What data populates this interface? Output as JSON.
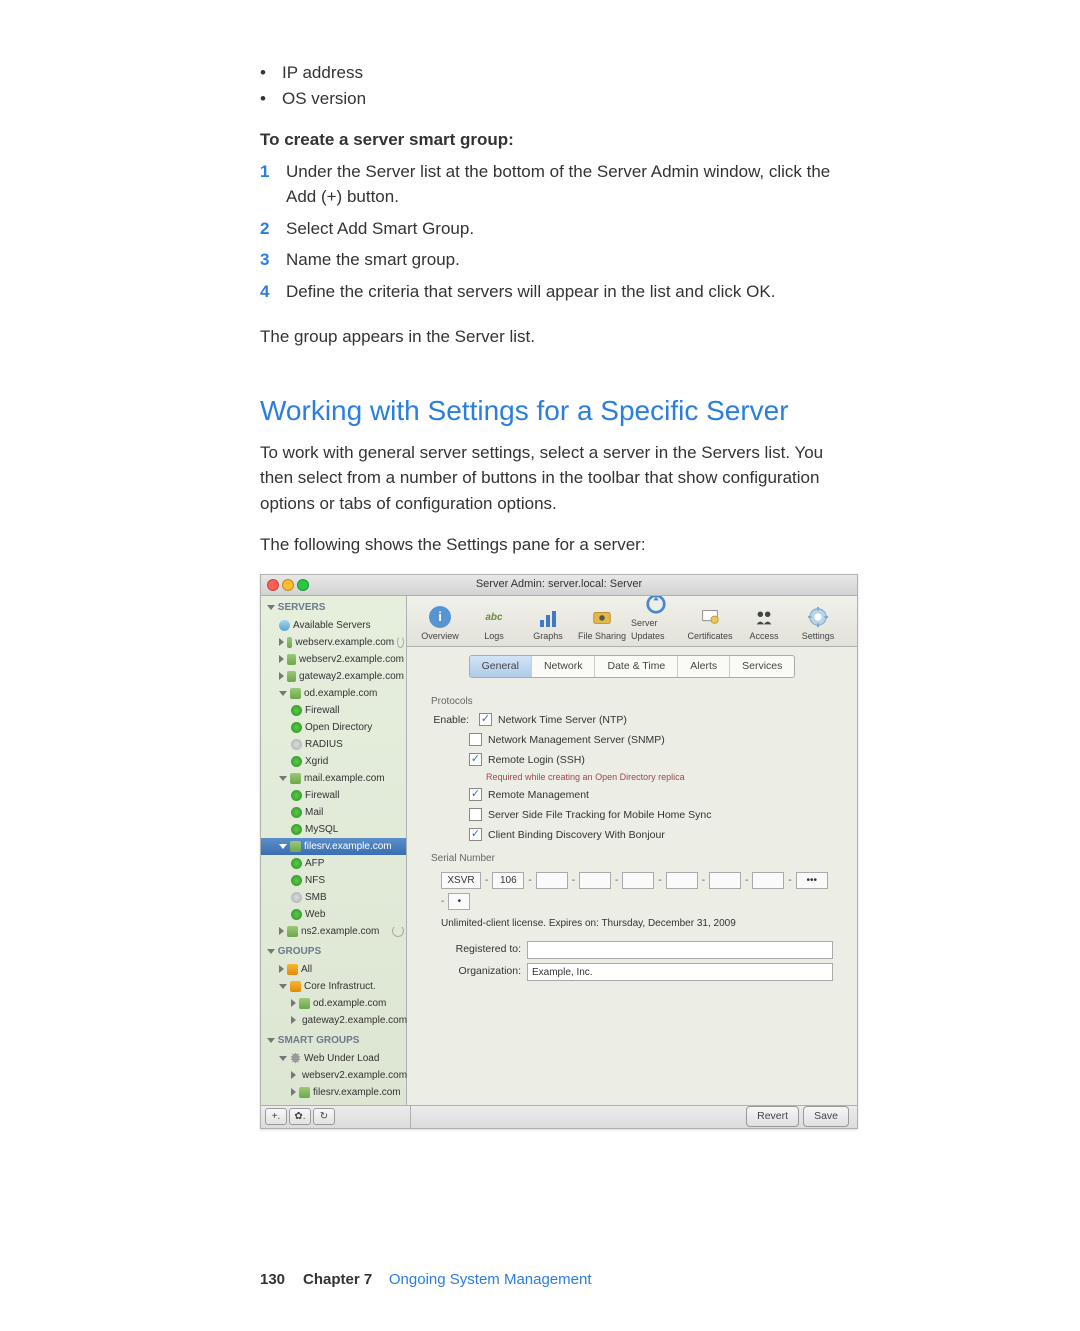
{
  "intro_bullets": [
    "IP address",
    "OS version"
  ],
  "procedure_title": "To create a server smart group:",
  "steps": [
    "Under the Server list at the bottom of the Server Admin window, click the Add (+) button.",
    "Select Add Smart Group.",
    "Name the smart group.",
    "Define the criteria that servers will appear in the list and click OK."
  ],
  "steps_after": "The group appears in the Server list.",
  "section_heading": "Working with Settings for a Specific Server",
  "section_body1": "To work with general server settings, select a server in the Servers list. You then select from a number of buttons in the toolbar that show configuration options or tabs of configuration options.",
  "section_body2": "The following shows the Settings pane for a server:",
  "window_title": "Server Admin: server.local: Server",
  "sidebar": {
    "h_servers": "SERVERS",
    "avail": "Available Servers",
    "srv1": "webserv.example.com",
    "srv2": "webserv2.example.com",
    "srv3": "gateway2.example.com",
    "srv4": "od.example.com",
    "svc_fw": "Firewall",
    "svc_od": "Open Directory",
    "svc_radius": "RADIUS",
    "svc_xgrid": "Xgrid",
    "srv5": "mail.example.com",
    "svc_mail": "Mail",
    "svc_mysql": "MySQL",
    "srv6": "filesrv.example.com",
    "svc_afp": "AFP",
    "svc_nfs": "NFS",
    "svc_smb": "SMB",
    "svc_web": "Web",
    "srv7": "ns2.example.com",
    "h_groups": "GROUPS",
    "grp_all": "All",
    "grp_core": "Core Infrastruct.",
    "grp_od": "od.example.com",
    "grp_gw": "gateway2.example.com",
    "h_smart": "SMART GROUPS",
    "sg_web": "Web Under Load",
    "sg_s1": "webserv2.example.com",
    "sg_s2": "filesrv.example.com"
  },
  "toolbar": {
    "overview": "Overview",
    "logs": "Logs",
    "graphs": "Graphs",
    "fileshare": "File Sharing",
    "updates": "Server Updates",
    "certs": "Certificates",
    "access": "Access",
    "settings": "Settings"
  },
  "tabs": {
    "general": "General",
    "network": "Network",
    "datetime": "Date & Time",
    "alerts": "Alerts",
    "services": "Services"
  },
  "content": {
    "protocols_label": "Protocols",
    "enable_label": "Enable:",
    "opt_ntp": "Network Time Server (NTP)",
    "opt_snmp": "Network Management Server (SNMP)",
    "opt_ssh": "Remote Login (SSH)",
    "ssh_hint": "Required while creating an Open Directory replica",
    "opt_remote_mgmt": "Remote Management",
    "opt_ssft": "Server Side File Tracking for Mobile Home Sync",
    "opt_bonjour": "Client Binding Discovery With Bonjour",
    "serial_label": "Serial Number",
    "serial_seg1": "XSVR",
    "serial_seg2": "106",
    "serial_dots": "•••",
    "serial_last": "•",
    "license_text": "Unlimited-client license. Expires on: Thursday, December 31, 2009",
    "registered_label": "Registered to:",
    "org_label": "Organization:",
    "org_value": "Example, Inc."
  },
  "buttons": {
    "revert": "Revert",
    "save": "Save",
    "add": "+.",
    "gear": "✿.",
    "refresh": "↻"
  },
  "footer": {
    "page": "130",
    "chapter_label": "Chapter 7",
    "chapter_title": "Ongoing System Management"
  }
}
